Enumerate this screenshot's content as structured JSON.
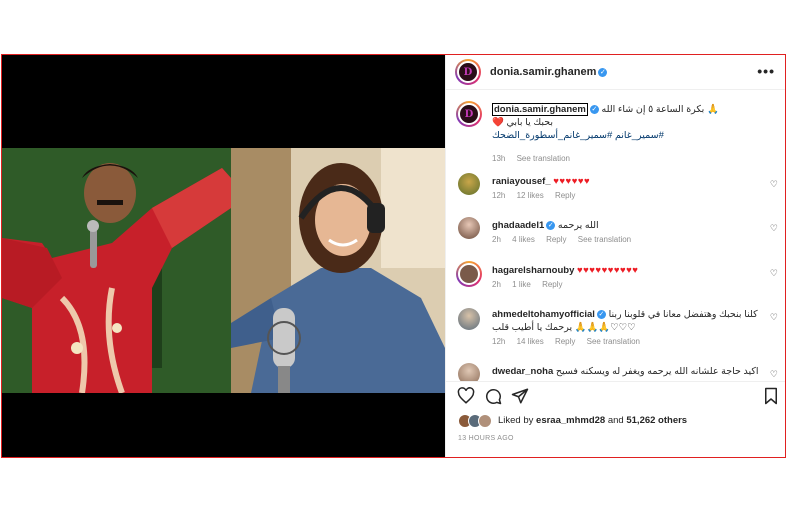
{
  "post": {
    "username": "donia.samir.ghanem",
    "more_label": "•••"
  },
  "caption": {
    "username": "donia.samir.ghanem",
    "line1": "بكرة الساعة ٥ إن شاء الله 🙏",
    "line2": "بحبك يا بابي ❤️",
    "tags": "#سمير_غانم #سمير_غانم_أسطورة_الضحك",
    "time": "13h",
    "translate": "See translation"
  },
  "comments": [
    {
      "username": "raniayousef_",
      "text": "♥♥♥♥♥♥",
      "time": "12h",
      "likes": "12 likes",
      "reply": "Reply",
      "translate": ""
    },
    {
      "username": "ghadaadel1",
      "text": "الله يرحمه",
      "time": "2h",
      "likes": "4 likes",
      "reply": "Reply",
      "translate": "See translation"
    },
    {
      "username": "hagarelsharnouby",
      "text": "♥♥♥♥♥♥♥♥♥♥",
      "time": "2h",
      "likes": "1 like",
      "reply": "Reply",
      "translate": ""
    },
    {
      "username": "ahmedeltohamyofficial",
      "text": "كلنا بنحبك وهتفضل معانا في قلوبنا ربنا يرحمك يا أطيب قلب 🙏🙏🙏♡♡♡",
      "time": "12h",
      "likes": "14 likes",
      "reply": "Reply",
      "translate": "See translation"
    },
    {
      "username": "dwedar_noha",
      "text": "اكيد حاجة علشانه الله يرحمه ويغفر له ويسكنه فسيح",
      "time": "",
      "likes": "",
      "reply": "",
      "translate": ""
    }
  ],
  "likes": {
    "prefix": "Liked by",
    "user": "esraa_mhmd28",
    "and": "and",
    "count": "51,262 others"
  },
  "timestamp": "13 HOURS AGO",
  "icons": [
    "heart-icon",
    "comment-icon",
    "share-icon",
    "save-icon",
    "more-icon",
    "verified-icon"
  ],
  "colors": {
    "accent": "#3897f0",
    "heart": "#ed1c24",
    "link": "#00376b",
    "border": "#e02020"
  }
}
